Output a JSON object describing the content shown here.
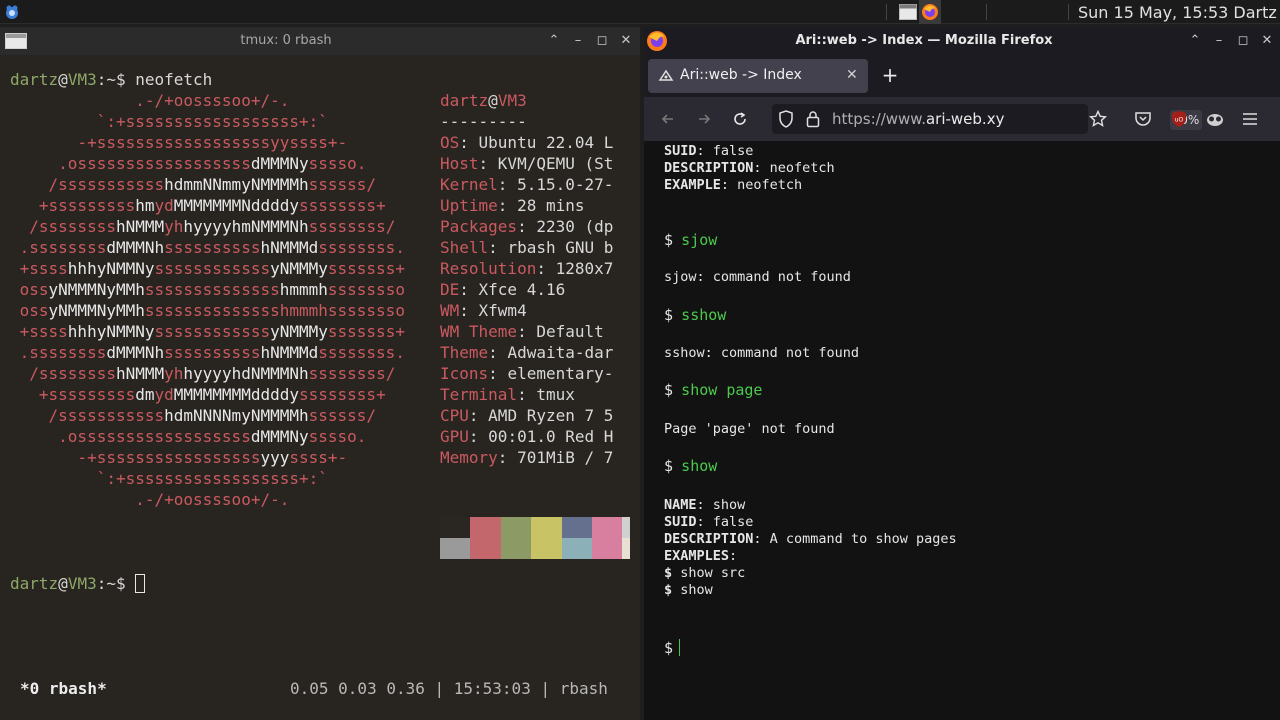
{
  "panel": {
    "clock": "Sun 15 May, 15:53",
    "user": "Dartz"
  },
  "terminal": {
    "title": "tmux: 0 rbash",
    "prompt_user": "dartz",
    "prompt_at": "@",
    "prompt_host": "VM3",
    "prompt_suffix": ":~$ ",
    "command": "neofetch",
    "logo_lines": [
      [
        [
          "r",
          "             .-/+oossssoo+/-."
        ]
      ],
      [
        [
          "r",
          "         `:+ssssssssssssssssss+:`"
        ]
      ],
      [
        [
          "r",
          "       -+ssssssssssssssssssyyssss+-"
        ]
      ],
      [
        [
          "r",
          "     .ossssssssssssssssss"
        ],
        [
          "w",
          "dMMMNy"
        ],
        [
          "r",
          "sssso."
        ]
      ],
      [
        [
          "r",
          "    /sssssssssss"
        ],
        [
          "w",
          "hdmmNNmmyNMMMMh"
        ],
        [
          "r",
          "ssssss/"
        ]
      ],
      [
        [
          "r",
          "   +sssssssss"
        ],
        [
          "w",
          "hm"
        ],
        [
          "r",
          "yd"
        ],
        [
          "w",
          "MMMMMMMNddddy"
        ],
        [
          "r",
          "ssssssss+"
        ]
      ],
      [
        [
          "r",
          "  /ssssssss"
        ],
        [
          "w",
          "hNMMM"
        ],
        [
          "r",
          "yh"
        ],
        [
          "w",
          "hyyyyhmNMMMNh"
        ],
        [
          "r",
          "ssssssss/"
        ]
      ],
      [
        [
          "r",
          " .ssssssss"
        ],
        [
          "w",
          "dMMMNh"
        ],
        [
          "r",
          "ssssssssss"
        ],
        [
          "w",
          "hNMMMd"
        ],
        [
          "r",
          "ssssssss."
        ]
      ],
      [
        [
          "r",
          " +ssss"
        ],
        [
          "w",
          "hhhyNMMNy"
        ],
        [
          "r",
          "ssssssssssss"
        ],
        [
          "w",
          "yNMMMy"
        ],
        [
          "r",
          "sssssss+"
        ]
      ],
      [
        [
          "r",
          " oss"
        ],
        [
          "w",
          "yNMMMNyMMh"
        ],
        [
          "r",
          "ssssssssssssss"
        ],
        [
          "w",
          "hmmmh"
        ],
        [
          "r",
          "ssssssso"
        ]
      ],
      [
        [
          "r",
          " oss"
        ],
        [
          "w",
          "yNMMMNyMMh"
        ],
        [
          "r",
          "sssssssssssssshmmmhssssssso"
        ]
      ],
      [
        [
          "r",
          " +ssss"
        ],
        [
          "w",
          "hhhyNMMNy"
        ],
        [
          "r",
          "ssssssssssss"
        ],
        [
          "w",
          "yNMMMy"
        ],
        [
          "r",
          "sssssss+"
        ]
      ],
      [
        [
          "r",
          " .ssssssss"
        ],
        [
          "w",
          "dMMMNh"
        ],
        [
          "r",
          "ssssssssss"
        ],
        [
          "w",
          "hNMMMd"
        ],
        [
          "r",
          "ssssssss."
        ]
      ],
      [
        [
          "r",
          "  /ssssssss"
        ],
        [
          "w",
          "hNMMM"
        ],
        [
          "r",
          "yh"
        ],
        [
          "w",
          "hyyyyhdNMMMNh"
        ],
        [
          "r",
          "ssssssss/"
        ]
      ],
      [
        [
          "r",
          "   +sssssssss"
        ],
        [
          "w",
          "dm"
        ],
        [
          "r",
          "yd"
        ],
        [
          "w",
          "MMMMMMMMddddy"
        ],
        [
          "r",
          "ssssssss+"
        ]
      ],
      [
        [
          "r",
          "    /sssssssssss"
        ],
        [
          "w",
          "hdmNNNNmyNMMMMh"
        ],
        [
          "r",
          "ssssss/"
        ]
      ],
      [
        [
          "r",
          "     .ossssssssssssssssss"
        ],
        [
          "w",
          "dMMMNy"
        ],
        [
          "r",
          "sssso."
        ]
      ],
      [
        [
          "r",
          "       -+sssssssssssssssss"
        ],
        [
          "w",
          "yyy"
        ],
        [
          "r",
          "ssss+-"
        ]
      ],
      [
        [
          "r",
          "         `:+ssssssssssssssssss+:`"
        ]
      ],
      [
        [
          "r",
          "             .-/+oossssoo+/-."
        ]
      ]
    ],
    "info_user": "dartz",
    "info_at": "@",
    "info_host": "VM3",
    "info_sep": "---------",
    "info": [
      {
        "key": "OS",
        "value": "Ubuntu 22.04 L"
      },
      {
        "key": "Host",
        "value": "KVM/QEMU (St"
      },
      {
        "key": "Kernel",
        "value": "5.15.0-27-"
      },
      {
        "key": "Uptime",
        "value": "28 mins"
      },
      {
        "key": "Packages",
        "value": "2230 (dp"
      },
      {
        "key": "Shell",
        "value": "rbash GNU b"
      },
      {
        "key": "Resolution",
        "value": "1280x7"
      },
      {
        "key": "DE",
        "value": "Xfce 4.16"
      },
      {
        "key": "WM",
        "value": "Xfwm4"
      },
      {
        "key": "WM Theme",
        "value": "Default"
      },
      {
        "key": "Theme",
        "value": "Adwaita-dar"
      },
      {
        "key": "Icons",
        "value": "elementary-"
      },
      {
        "key": "Terminal",
        "value": "tmux"
      },
      {
        "key": "CPU",
        "value": "AMD Ryzen 7 5"
      },
      {
        "key": "GPU",
        "value": "00:01.0 Red H"
      },
      {
        "key": "Memory",
        "value": "701MiB / 7"
      }
    ],
    "palette_top": [
      "#2a2622",
      "#c4676d",
      "#8c9a66",
      "#c8c465",
      "#65708f",
      "#d87fa0",
      "#d0d0d0"
    ],
    "palette_bottom": [
      "#9a9a9a",
      "#c4676d",
      "#8c9a66",
      "#c8c465",
      "#8cb0b8",
      "#d87fa0",
      "#e8e0d0"
    ],
    "status_left": "*0 rbash*",
    "status_right": "0.05 0.03 0.36 | 15:53:03 | rbash"
  },
  "firefox": {
    "title": "Ari::web -> Index — Mozilla Firefox",
    "tab_label": "Ari::web -> Index",
    "url_prefix": "https://www.",
    "url_domain": "ari-web.xy",
    "zoom": "80%",
    "page": {
      "top_suid_label": "SUID",
      "top_suid_value": ": false",
      "top_desc_label": "DESCRIPTION",
      "top_desc_value": ": neofetch",
      "top_example_label": "EXAMPLE",
      "top_example_value": ": neofetch",
      "cmd1": "sjow",
      "out1": "sjow: command not found",
      "cmd2": "sshow",
      "out2": "sshow: command not found",
      "cmd3": "show page",
      "out3": "Page 'page' not found",
      "cmd4": "show",
      "name_label": "NAME",
      "name_value": ": show",
      "suid_label": "SUID",
      "suid_value": ": false",
      "desc_label": "DESCRIPTION",
      "desc_value": ": A command to show pages",
      "examples_label": "EXAMPLES",
      "examples_colon": ":",
      "ex1": " show src",
      "ex2": " show",
      "dollar": "$"
    }
  }
}
